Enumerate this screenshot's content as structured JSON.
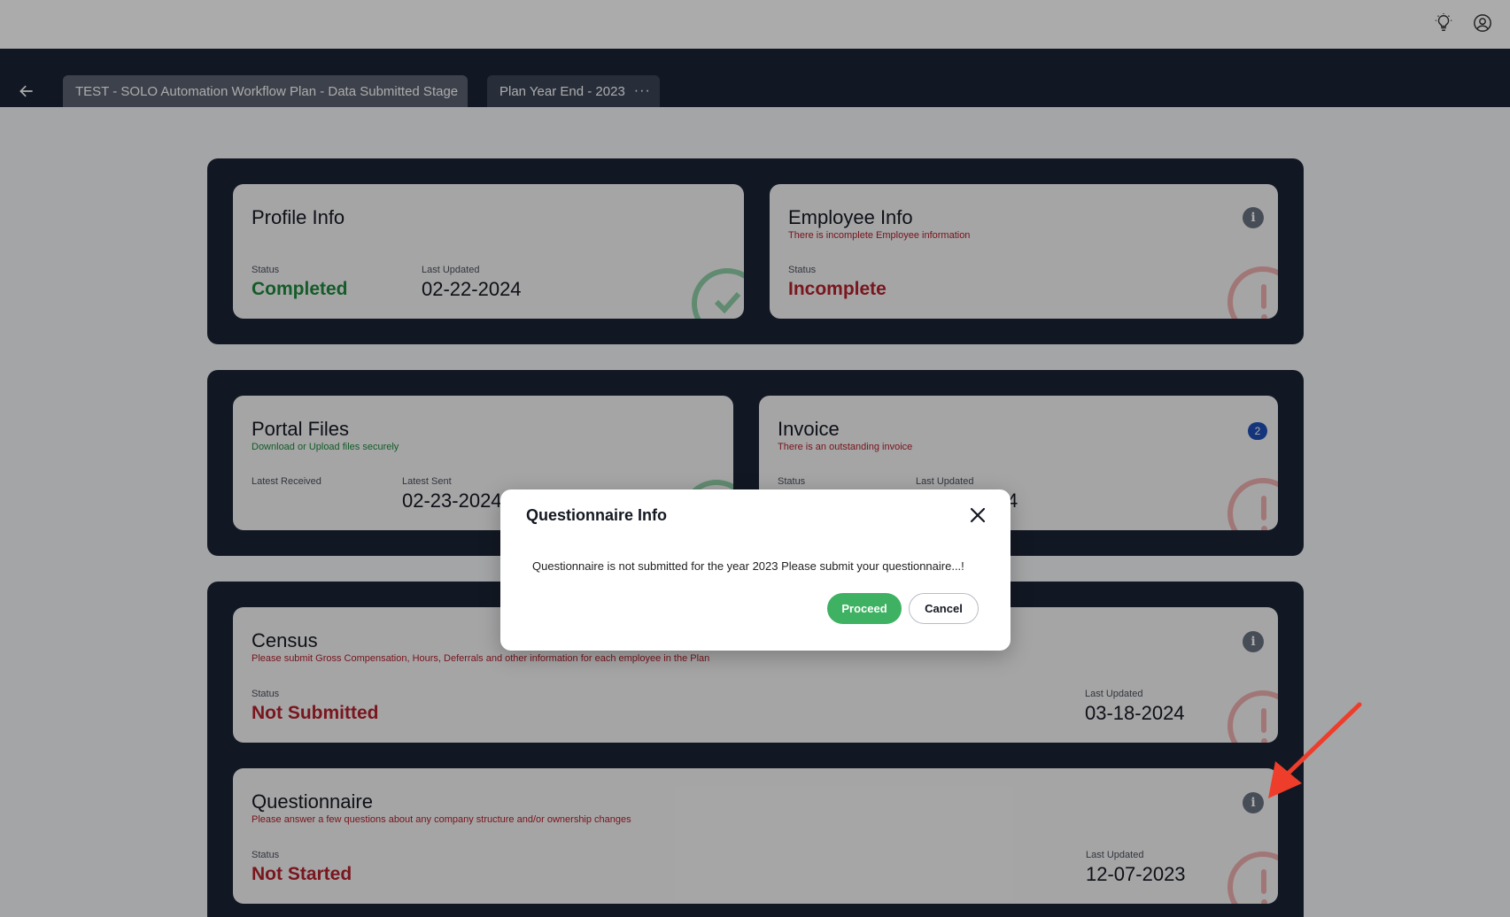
{
  "header": {
    "back_icon": "arrow-left-icon",
    "theme_icon": "lightbulb-icon",
    "profile_icon": "user-circle-icon"
  },
  "tabs": [
    {
      "label": "TEST - SOLO Automation Workflow Plan - Data Submitted Stage"
    },
    {
      "label": "Plan Year End - 2023",
      "more": "···"
    }
  ],
  "cards": {
    "profile": {
      "title": "Profile Info",
      "status_label": "Status",
      "status": "Completed",
      "updated_label": "Last Updated",
      "updated": "02-22-2024"
    },
    "employee": {
      "title": "Employee Info",
      "subtitle": "There is incomplete Employee information",
      "status_label": "Status",
      "status": "Incomplete"
    },
    "portal": {
      "title": "Portal Files",
      "subtitle": "Download or Upload files securely",
      "received_label": "Latest Received",
      "sent_label": "Latest Sent",
      "sent": "02-23-2024"
    },
    "invoice": {
      "title": "Invoice",
      "subtitle": "There is an outstanding invoice",
      "badge": "2",
      "status_label": "Status",
      "updated_label": "Last Updated",
      "updated": "4"
    },
    "census": {
      "title": "Census",
      "subtitle": "Please submit Gross Compensation, Hours, Deferrals and other information for each employee in the Plan",
      "status_label": "Status",
      "status": "Not Submitted",
      "updated_label": "Last Updated",
      "updated": "03-18-2024"
    },
    "questionnaire": {
      "title": "Questionnaire",
      "subtitle": "Please answer a few questions about any company structure and/or ownership changes",
      "status_label": "Status",
      "status": "Not Started",
      "updated_label": "Last Updated",
      "updated": "12-07-2023"
    }
  },
  "modal": {
    "title": "Questionnaire Info",
    "message": "Questionnaire is not submitted for the year 2023 Please submit your questionnaire...!",
    "proceed": "Proceed",
    "cancel": "Cancel"
  },
  "colors": {
    "accent_green": "#3fb162",
    "status_red": "#b5222d",
    "status_green": "#1f8a3e",
    "dark_band": "#1b2535"
  }
}
